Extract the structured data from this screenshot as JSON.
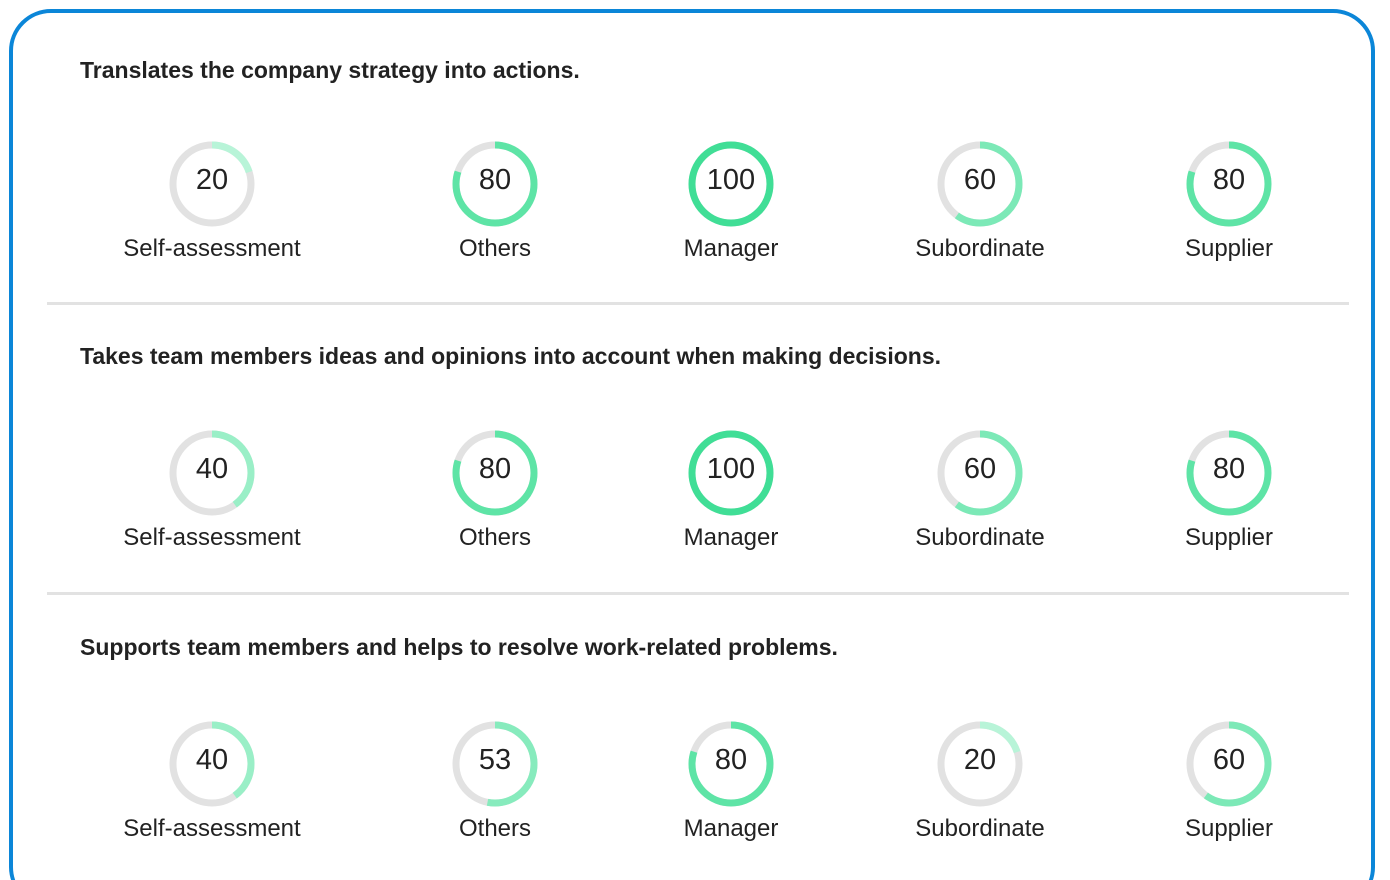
{
  "colors": {
    "border": "#0b86d8",
    "track": "#e2e2e2",
    "divider": "#e2e2e2",
    "text": "#222222"
  },
  "sections": [
    {
      "title": "Translates the company strategy into actions.",
      "scores": [
        {
          "label": "Self-assessment",
          "value": 20,
          "display": "20"
        },
        {
          "label": "Others",
          "value": 80,
          "display": "80"
        },
        {
          "label": "Manager",
          "value": 100,
          "display": "100"
        },
        {
          "label": "Subordinate",
          "value": 60,
          "display": "60"
        },
        {
          "label": "Supplier",
          "value": 80,
          "display": "80"
        }
      ]
    },
    {
      "title": "Takes team members ideas and opinions into account when making decisions.",
      "scores": [
        {
          "label": "Self-assessment",
          "value": 40,
          "display": "40"
        },
        {
          "label": "Others",
          "value": 80,
          "display": "80"
        },
        {
          "label": "Manager",
          "value": 100,
          "display": "100"
        },
        {
          "label": "Subordinate",
          "value": 60,
          "display": "60"
        },
        {
          "label": "Supplier",
          "value": 80,
          "display": "80"
        }
      ]
    },
    {
      "title": "Supports team members and helps to resolve work-related problems.",
      "scores": [
        {
          "label": "Self-assessment",
          "value": 40,
          "display": "40"
        },
        {
          "label": "Others",
          "value": 53,
          "display": "53"
        },
        {
          "label": "Manager",
          "value": 80,
          "display": "80"
        },
        {
          "label": "Subordinate",
          "value": 20,
          "display": "20"
        },
        {
          "label": "Supplier",
          "value": 60,
          "display": "60"
        }
      ]
    }
  ]
}
